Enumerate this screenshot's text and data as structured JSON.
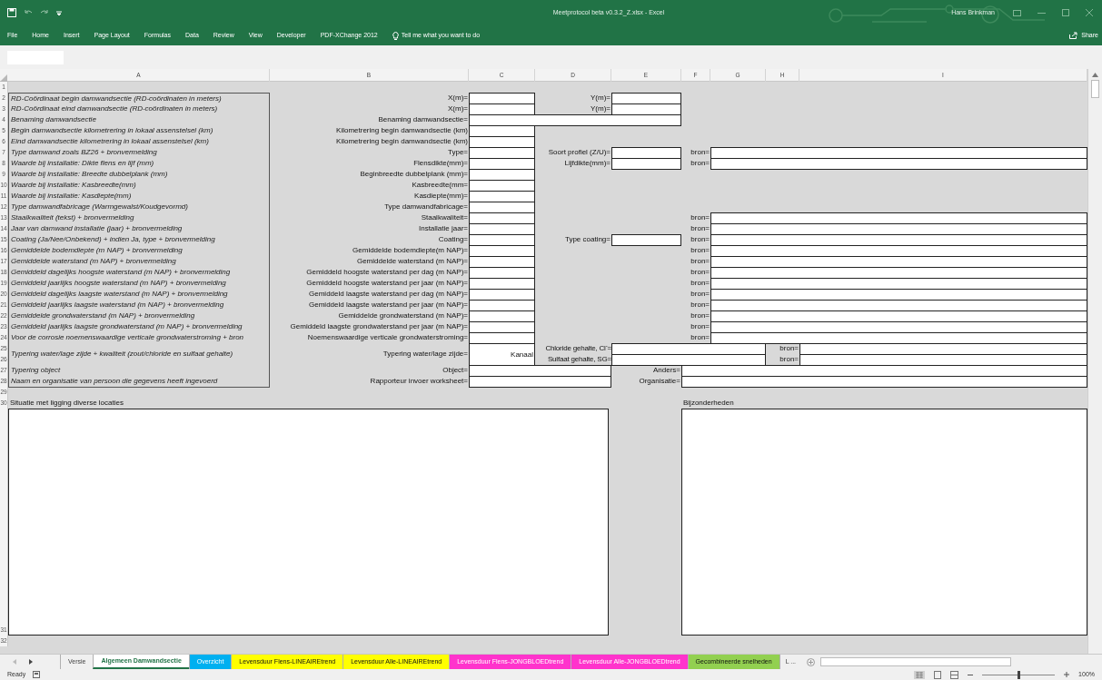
{
  "titlebar": {
    "title": "Meetprotocol beta v0.3.2_Z.xlsx  -  Excel",
    "user": "Hans Brinkman"
  },
  "ribbon_tabs": [
    "File",
    "Home",
    "Insert",
    "Page Layout",
    "Formulas",
    "Data",
    "Review",
    "View",
    "Developer",
    "PDF-XChange 2012"
  ],
  "tell_me": "Tell me what you want to do",
  "share": "Share",
  "columns": [
    "A",
    "B",
    "C",
    "D",
    "E",
    "F",
    "G",
    "H",
    "I"
  ],
  "rows": [
    {
      "kind": "blank",
      "number": "1"
    },
    {
      "kind": "standard",
      "number": "2",
      "description": "RD-Coördinaat begin damwandsectie (RD-coördinaten in meters)",
      "label": "X(m)=",
      "extra": {
        "label": "Y(m)="
      }
    },
    {
      "kind": "standard",
      "number": "3",
      "description": "RD-Coördinaat eind damwandsectie (RD-coördinaten in meters)",
      "label": "X(m)=",
      "extra": {
        "label": "Y(m)="
      }
    },
    {
      "kind": "wide",
      "number": "4",
      "description": "Benaming damwandsectie",
      "label": "Benaming damwandsectie="
    },
    {
      "kind": "standard",
      "number": "5",
      "description": "Begin damwandsectie kilometrering in lokaal assenstelsel (km)",
      "label": "Kilometrering begin damwandsectie (km)"
    },
    {
      "kind": "standard",
      "number": "6",
      "description": "Eind damwandsectie kilometrering in lokaal assenstelsel (km)",
      "label": "Kilometrering begin damwandsectie (km)"
    },
    {
      "kind": "standard",
      "number": "7",
      "description": "Type damwand zoals BZ26 + bronvermelding",
      "label": "Type=",
      "extra": {
        "label": "Soort profiel (Z/U)="
      },
      "source": "bron="
    },
    {
      "kind": "standard",
      "number": "8",
      "description": "Waarde bij installatie: Dikte flens en lijf (mm)",
      "label": "Flensdikte(mm)=",
      "extra": {
        "label": "Lijfdikte(mm)="
      },
      "source": "bron="
    },
    {
      "kind": "standard",
      "number": "9",
      "description": "Waarde bij installatie: Breedte dubbelplank (mm)",
      "label": "Beginbreedte dubbelplank (mm)="
    },
    {
      "kind": "standard",
      "number": "10",
      "description": "Waarde bij installatie: Kasbreedte(mm)",
      "label": "Kasbreedte(mm="
    },
    {
      "kind": "standard",
      "number": "11",
      "description": "Waarde bij installatie: Kasdiepte(mm)",
      "label": "Kasdiepte(mm)="
    },
    {
      "kind": "standard",
      "number": "12",
      "description": "Type damwandfabricage (Warmgewalst/Koudgevormd)",
      "label": "Type damwandfabricage="
    },
    {
      "kind": "standard",
      "number": "13",
      "description": "Staalkwaliteit (tekst) + bronvermelding",
      "label": "Staalkwaliteit=",
      "source": "bron="
    },
    {
      "kind": "standard",
      "number": "14",
      "description": "Jaar van damwand installatie (jaar) + bronvermelding",
      "label": "Installatie jaar=",
      "source": "bron="
    },
    {
      "kind": "standard",
      "number": "15",
      "description": "Coating (Ja/Nee/Onbekend) + indien Ja, type + bronvermelding",
      "label": "Coating=",
      "extra": {
        "label": "Type coating="
      },
      "source": "bron="
    },
    {
      "kind": "standard",
      "number": "16",
      "description": "Gemiddelde bodemdiepte (m NAP) + bronvermelding",
      "label": "Gemiddelde bodemdiepte(m NAP)=",
      "source": "bron="
    },
    {
      "kind": "standard",
      "number": "17",
      "description": "Gemiddelde waterstand (m NAP) + bronvermelding",
      "label": "Gemiddelde waterstand (m NAP)=",
      "source": "bron="
    },
    {
      "kind": "standard",
      "number": "18",
      "description": "Gemiddeld dagelijks hoogste waterstand (m NAP) + bronvermelding",
      "label": "Gemiddeld hoogste waterstand per dag (m NAP)=",
      "source": "bron="
    },
    {
      "kind": "standard",
      "number": "19",
      "description": "Gemiddeld jaarlijks hoogste waterstand (m NAP) + bronvermelding",
      "label": "Gemiddeld hoogste waterstand per jaar (m NAP)=",
      "source": "bron="
    },
    {
      "kind": "standard",
      "number": "20",
      "description": "Gemiddeld dagelijks laagste waterstand (m NAP) + bronvermelding",
      "label": "Gemiddeld laagste waterstand per dag (m NAP)=",
      "source": "bron="
    },
    {
      "kind": "standard",
      "number": "21",
      "description": "Gemiddeld jaarlijks laagste waterstand (m NAP) + bronvermelding",
      "label": "Gemiddeld laagste waterstand per jaar (m NAP)=",
      "source": "bron="
    },
    {
      "kind": "standard",
      "number": "22",
      "description": "Gemiddelde grondwaterstand (m NAP) + bronvermelding",
      "label": "Gemiddelde grondwaterstand (m NAP)=",
      "source": "bron="
    },
    {
      "kind": "standard",
      "number": "23",
      "description": "Gemiddeld jaarlijks laagste grondwaterstand (m NAP) + bronvermelding",
      "label": "Gemiddeld laagste grondwaterstand per jaar (m NAP)=",
      "source": "bron="
    },
    {
      "kind": "standard",
      "number": "24",
      "description": "Voor de corrosie noemenswaardige verticale grondwaterstroming + bron",
      "label": "Noemenswaardige verticale grondwaterstroming=",
      "source": "bron="
    },
    {
      "kind": "paired",
      "numbers": [
        "25",
        "26"
      ],
      "description": "Typering water/lage zijde + kwaliteit (zout/chloride en sulfaat gehalte)",
      "label": "Typering water/lage zijde=",
      "channel": "Kanaal",
      "parts": [
        {
          "label": "Chloride gehalte, Cl$^{-}$=",
          "source": "bron="
        },
        {
          "label": "Sulfaat gehalte, SG=",
          "source": "bron="
        }
      ]
    },
    {
      "kind": "person",
      "number": "27",
      "description": "Typering object",
      "label": "Object=",
      "extra": {
        "label": "Anders="
      }
    },
    {
      "kind": "person",
      "number": "28",
      "description": "Naam en organisatie van persoon die gegevens heeft ingevoerd",
      "label": "Rapporteur invoer worksheet=",
      "extra": {
        "label": "Organisatie="
      }
    },
    {
      "kind": "blank",
      "number": "29"
    },
    {
      "kind": "headings",
      "number": "30",
      "left": "Situatie met ligging diverse locaties",
      "right": "Bijzonderheden"
    },
    {
      "kind": "boxes",
      "number": "31"
    },
    {
      "kind": "blank",
      "number": "32"
    }
  ],
  "sheet_tabs": [
    {
      "label": "Versie",
      "selected": false
    },
    {
      "label": "Algemeen Damwandsectie",
      "selected": true
    },
    {
      "label": "Overzicht",
      "selected": false,
      "color": "#00b0f0"
    },
    {
      "label": "Levensduur Flens-LINEAIREtrend",
      "selected": false,
      "color": "#ffff00"
    },
    {
      "label": "Levensduur Alle-LINEAIREtrend",
      "selected": false,
      "color": "#ffff00"
    },
    {
      "label": "Levensduur Flens-JONGBLOEDtrend",
      "selected": false,
      "color": "#ff33cc"
    },
    {
      "label": "Levensduur Alle-JONGBLOEDtrend",
      "selected": false,
      "color": "#ff33cc"
    },
    {
      "label": "Gecombineerde snelheden",
      "selected": false,
      "color": "#92d050"
    }
  ],
  "more_tabs": "L ...",
  "status": {
    "text": "Ready",
    "zoom": {
      "level": 0.5,
      "reading": "100%"
    }
  }
}
